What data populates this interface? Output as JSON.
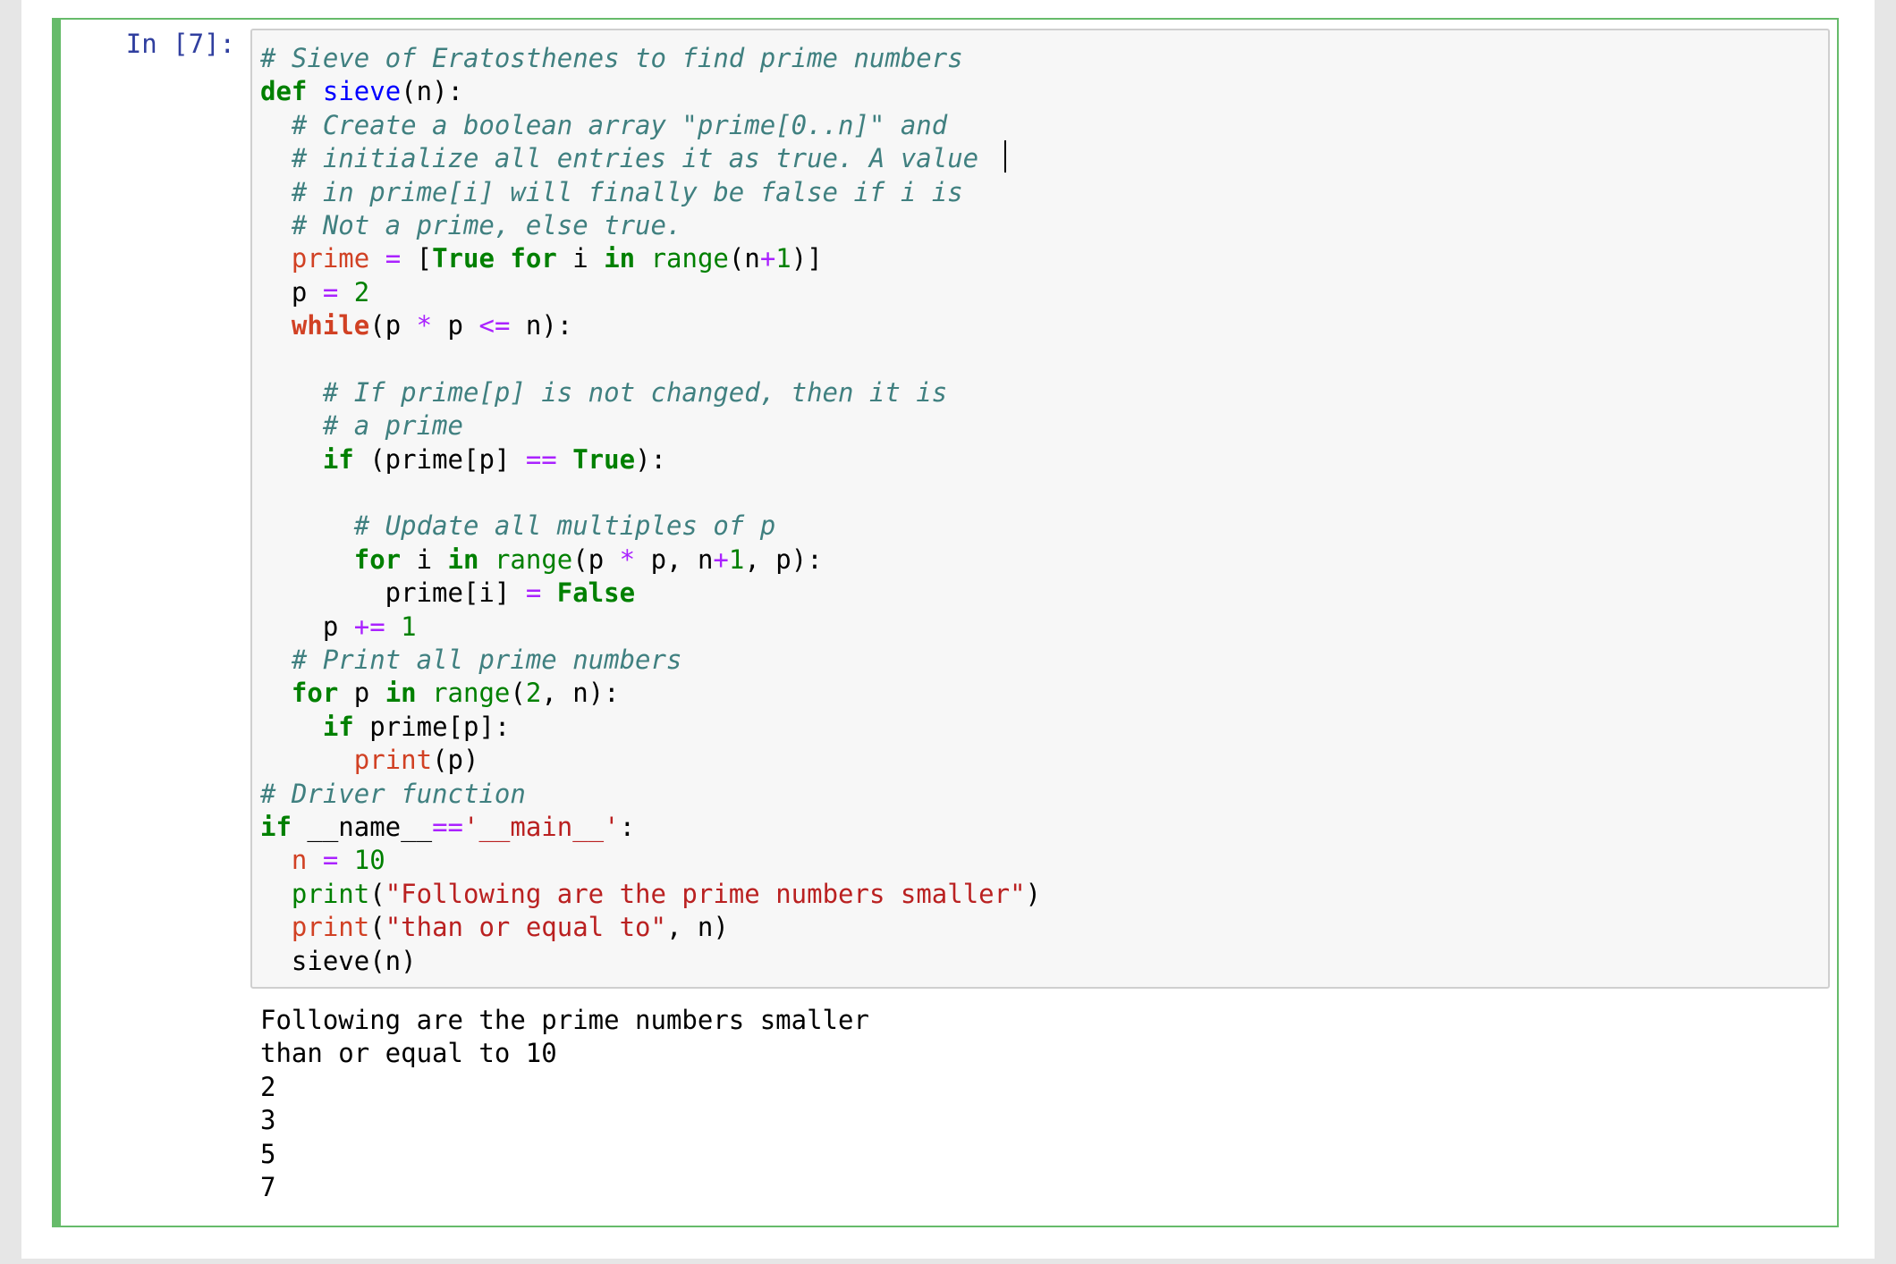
{
  "cell": {
    "prompt": "In [7]:",
    "code_lines": [
      [
        {
          "t": "# Sieve of Eratosthenes to find prime numbers",
          "c": "cm"
        }
      ],
      [
        {
          "t": "def",
          "c": "kw"
        },
        {
          "t": " ",
          "c": "tx"
        },
        {
          "t": "sieve",
          "c": "fn"
        },
        {
          "t": "(n):",
          "c": "tx"
        }
      ],
      [
        {
          "t": "  ",
          "c": "tx"
        },
        {
          "t": "# Create a boolean array \"prime[0..n]\" and",
          "c": "cm"
        }
      ],
      [
        {
          "t": "  ",
          "c": "tx"
        },
        {
          "t": "# initialize all entries it as true. A value",
          "c": "cm"
        }
      ],
      [
        {
          "t": "  ",
          "c": "tx"
        },
        {
          "t": "# in prime[i] will finally be false if i is",
          "c": "cm"
        }
      ],
      [
        {
          "t": "  ",
          "c": "tx"
        },
        {
          "t": "# Not a prime, else true.",
          "c": "cm"
        }
      ],
      [
        {
          "t": "  ",
          "c": "tx"
        },
        {
          "t": "prime",
          "c": "var"
        },
        {
          "t": " ",
          "c": "tx"
        },
        {
          "t": "=",
          "c": "op"
        },
        {
          "t": " [",
          "c": "tx"
        },
        {
          "t": "True",
          "c": "kw"
        },
        {
          "t": " ",
          "c": "tx"
        },
        {
          "t": "for",
          "c": "kw"
        },
        {
          "t": " i ",
          "c": "tx"
        },
        {
          "t": "in",
          "c": "kw"
        },
        {
          "t": " ",
          "c": "tx"
        },
        {
          "t": "range",
          "c": "bi"
        },
        {
          "t": "(n",
          "c": "tx"
        },
        {
          "t": "+",
          "c": "op"
        },
        {
          "t": "1",
          "c": "num"
        },
        {
          "t": ")]",
          "c": "tx"
        }
      ],
      [
        {
          "t": "  p ",
          "c": "tx"
        },
        {
          "t": "=",
          "c": "op"
        },
        {
          "t": " ",
          "c": "tx"
        },
        {
          "t": "2",
          "c": "num"
        }
      ],
      [
        {
          "t": "  ",
          "c": "tx"
        },
        {
          "t": "while",
          "c": "var kw"
        },
        {
          "t": "(p ",
          "c": "tx"
        },
        {
          "t": "*",
          "c": "op"
        },
        {
          "t": " p ",
          "c": "tx"
        },
        {
          "t": "<=",
          "c": "op"
        },
        {
          "t": " n):",
          "c": "tx"
        }
      ],
      [
        {
          "t": "",
          "c": "tx"
        }
      ],
      [
        {
          "t": "    ",
          "c": "tx"
        },
        {
          "t": "# If prime[p] is not changed, then it is",
          "c": "cm"
        }
      ],
      [
        {
          "t": "    ",
          "c": "tx"
        },
        {
          "t": "# a prime",
          "c": "cm"
        }
      ],
      [
        {
          "t": "    ",
          "c": "tx"
        },
        {
          "t": "if",
          "c": "kw"
        },
        {
          "t": " (prime[p] ",
          "c": "tx"
        },
        {
          "t": "==",
          "c": "op"
        },
        {
          "t": " ",
          "c": "tx"
        },
        {
          "t": "True",
          "c": "kw"
        },
        {
          "t": "):",
          "c": "tx"
        }
      ],
      [
        {
          "t": "",
          "c": "tx"
        }
      ],
      [
        {
          "t": "      ",
          "c": "tx"
        },
        {
          "t": "# Update all multiples of p",
          "c": "cm"
        }
      ],
      [
        {
          "t": "      ",
          "c": "tx"
        },
        {
          "t": "for",
          "c": "kw"
        },
        {
          "t": " i ",
          "c": "tx"
        },
        {
          "t": "in",
          "c": "kw"
        },
        {
          "t": " ",
          "c": "tx"
        },
        {
          "t": "range",
          "c": "bi"
        },
        {
          "t": "(p ",
          "c": "tx"
        },
        {
          "t": "*",
          "c": "op"
        },
        {
          "t": " p, n",
          "c": "tx"
        },
        {
          "t": "+",
          "c": "op"
        },
        {
          "t": "1",
          "c": "num"
        },
        {
          "t": ", p):",
          "c": "tx"
        }
      ],
      [
        {
          "t": "        prime[i] ",
          "c": "tx"
        },
        {
          "t": "=",
          "c": "op"
        },
        {
          "t": " ",
          "c": "tx"
        },
        {
          "t": "False",
          "c": "kw"
        }
      ],
      [
        {
          "t": "    p ",
          "c": "tx"
        },
        {
          "t": "+=",
          "c": "op"
        },
        {
          "t": " ",
          "c": "tx"
        },
        {
          "t": "1",
          "c": "num"
        }
      ],
      [
        {
          "t": "  ",
          "c": "tx"
        },
        {
          "t": "# Print all prime numbers",
          "c": "cm"
        }
      ],
      [
        {
          "t": "  ",
          "c": "tx"
        },
        {
          "t": "for",
          "c": "kw"
        },
        {
          "t": " p ",
          "c": "tx"
        },
        {
          "t": "in",
          "c": "kw"
        },
        {
          "t": " ",
          "c": "tx"
        },
        {
          "t": "range",
          "c": "bi"
        },
        {
          "t": "(",
          "c": "tx"
        },
        {
          "t": "2",
          "c": "num"
        },
        {
          "t": ", n):",
          "c": "tx"
        }
      ],
      [
        {
          "t": "    ",
          "c": "tx"
        },
        {
          "t": "if",
          "c": "kw"
        },
        {
          "t": " prime[p]:",
          "c": "tx"
        }
      ],
      [
        {
          "t": "      ",
          "c": "tx"
        },
        {
          "t": "print",
          "c": "var"
        },
        {
          "t": "(p)",
          "c": "tx"
        }
      ],
      [
        {
          "t": "# Driver function",
          "c": "cm"
        }
      ],
      [
        {
          "t": "if",
          "c": "kw"
        },
        {
          "t": " __name__",
          "c": "tx"
        },
        {
          "t": "==",
          "c": "op"
        },
        {
          "t": "'__main__'",
          "c": "str"
        },
        {
          "t": ":",
          "c": "tx"
        }
      ],
      [
        {
          "t": "  ",
          "c": "tx"
        },
        {
          "t": "n",
          "c": "var"
        },
        {
          "t": " ",
          "c": "tx"
        },
        {
          "t": "=",
          "c": "op"
        },
        {
          "t": " ",
          "c": "tx"
        },
        {
          "t": "10",
          "c": "num"
        }
      ],
      [
        {
          "t": "  ",
          "c": "tx"
        },
        {
          "t": "print",
          "c": "bi"
        },
        {
          "t": "(",
          "c": "tx"
        },
        {
          "t": "\"Following are the prime numbers smaller\"",
          "c": "str"
        },
        {
          "t": ")",
          "c": "tx"
        }
      ],
      [
        {
          "t": "  ",
          "c": "tx"
        },
        {
          "t": "print",
          "c": "var"
        },
        {
          "t": "(",
          "c": "tx"
        },
        {
          "t": "\"than or equal to\"",
          "c": "str"
        },
        {
          "t": ", n)",
          "c": "tx"
        }
      ],
      [
        {
          "t": "  sieve(n)",
          "c": "tx"
        }
      ]
    ],
    "output_lines": [
      "Following are the prime numbers smaller",
      "than or equal to 10",
      "2",
      "3",
      "5",
      "7"
    ]
  }
}
